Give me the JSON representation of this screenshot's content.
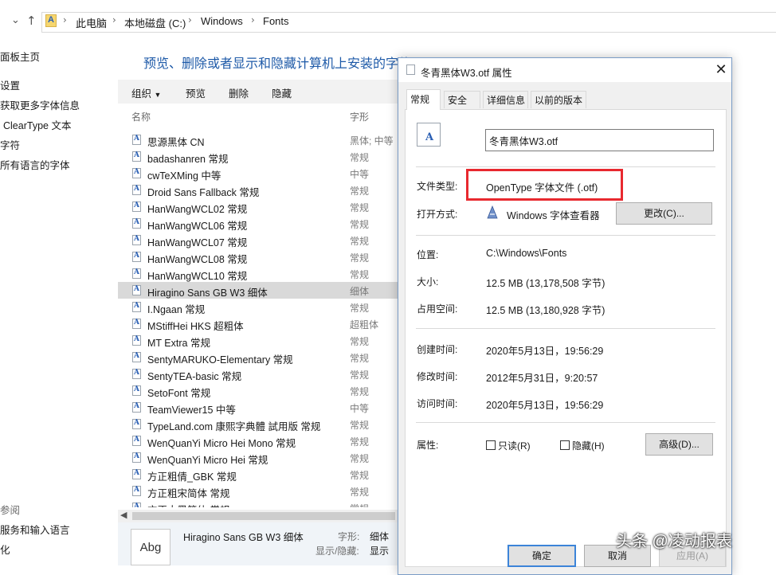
{
  "address_bar": {
    "crumbs": [
      "此电脑",
      "本地磁盘 (C:)",
      "Windows",
      "Fonts"
    ]
  },
  "left_pane": {
    "items": [
      "面板主页",
      "设置",
      "获取更多字体信息",
      "ClearType 文本",
      "字符",
      "所有语言的字体"
    ],
    "see_also_header": "参阅",
    "see_also_items": [
      "服务和输入语言",
      "化"
    ]
  },
  "main": {
    "title": "预览、删除或者显示和隐藏计算机上安装的字体",
    "toolbar": {
      "organize": "组织",
      "preview": "预览",
      "delete": "删除",
      "hide": "隐藏"
    },
    "columns": {
      "name": "名称",
      "style": "字形"
    },
    "fonts": [
      {
        "name": "思源黑体 CN",
        "style": "黑体; 中等"
      },
      {
        "name": "badashanren 常规",
        "style": "常规"
      },
      {
        "name": "cwTeXMing 中等",
        "style": "中等"
      },
      {
        "name": "Droid Sans Fallback 常规",
        "style": "常规"
      },
      {
        "name": "HanWangWCL02 常规",
        "style": "常规"
      },
      {
        "name": "HanWangWCL06 常规",
        "style": "常规"
      },
      {
        "name": "HanWangWCL07 常规",
        "style": "常规"
      },
      {
        "name": "HanWangWCL08 常规",
        "style": "常规"
      },
      {
        "name": "HanWangWCL10 常规",
        "style": "常规"
      },
      {
        "name": "Hiragino Sans GB W3 细体",
        "style": "细体"
      },
      {
        "name": "I.Ngaan 常规",
        "style": "常规"
      },
      {
        "name": "MStiffHei HKS 超粗体",
        "style": "超粗体"
      },
      {
        "name": "MT Extra 常规",
        "style": "常规"
      },
      {
        "name": "SentyMARUKO-Elementary 常规",
        "style": "常规"
      },
      {
        "name": "SentyTEA-basic 常规",
        "style": "常规"
      },
      {
        "name": "SetoFont 常规",
        "style": "常规"
      },
      {
        "name": "TeamViewer15 中等",
        "style": "中等"
      },
      {
        "name": "TypeLand.com 康熙字典體 試用版 常规",
        "style": "常规"
      },
      {
        "name": "WenQuanYi Micro Hei Mono 常规",
        "style": "常规"
      },
      {
        "name": "WenQuanYi Micro Hei 常规",
        "style": "常规"
      },
      {
        "name": "方正粗倩_GBK 常规",
        "style": "常规"
      },
      {
        "name": "方正粗宋简体 常规",
        "style": "常规"
      },
      {
        "name": "方正大黑简体 常规",
        "style": "常规"
      }
    ],
    "selected_index": 9
  },
  "details_pane": {
    "preview_text": "Abg",
    "font_name": "Hiragino Sans GB W3 细体",
    "style_label": "字形:",
    "style_value": "细体",
    "visibility_label": "显示/隐藏:",
    "visibility_value": "显示"
  },
  "dialog": {
    "title": "冬青黑体W3.otf 属性",
    "tabs": [
      "常规",
      "安全",
      "详细信息",
      "以前的版本"
    ],
    "file_name": "冬青黑体W3.otf",
    "file_type_label": "文件类型:",
    "file_type_value": "OpenType 字体文件 (.otf)",
    "open_with_label": "打开方式:",
    "open_with_value": "Windows 字体查看器",
    "change_button": "更改(C)...",
    "location_label": "位置:",
    "location_value": "C:\\Windows\\Fonts",
    "size_label": "大小:",
    "size_value": "12.5 MB (13,178,508 字节)",
    "disk_size_label": "占用空间:",
    "disk_size_value": "12.5 MB (13,180,928 字节)",
    "created_label": "创建时间:",
    "created_value": "2020年5月13日，19:56:29",
    "modified_label": "修改时间:",
    "modified_value": "2012年5月31日，9:20:57",
    "accessed_label": "访问时间:",
    "accessed_value": "2020年5月13日，19:56:29",
    "attributes_label": "属性:",
    "readonly_label": "只读(R)",
    "hidden_label": "隐藏(H)",
    "advanced_button": "高级(D)...",
    "ok_button": "确定",
    "cancel_button": "取消",
    "apply_button": "应用(A)",
    "highlight_color": "#e8292f"
  },
  "watermark": "头条 @凌动报表"
}
